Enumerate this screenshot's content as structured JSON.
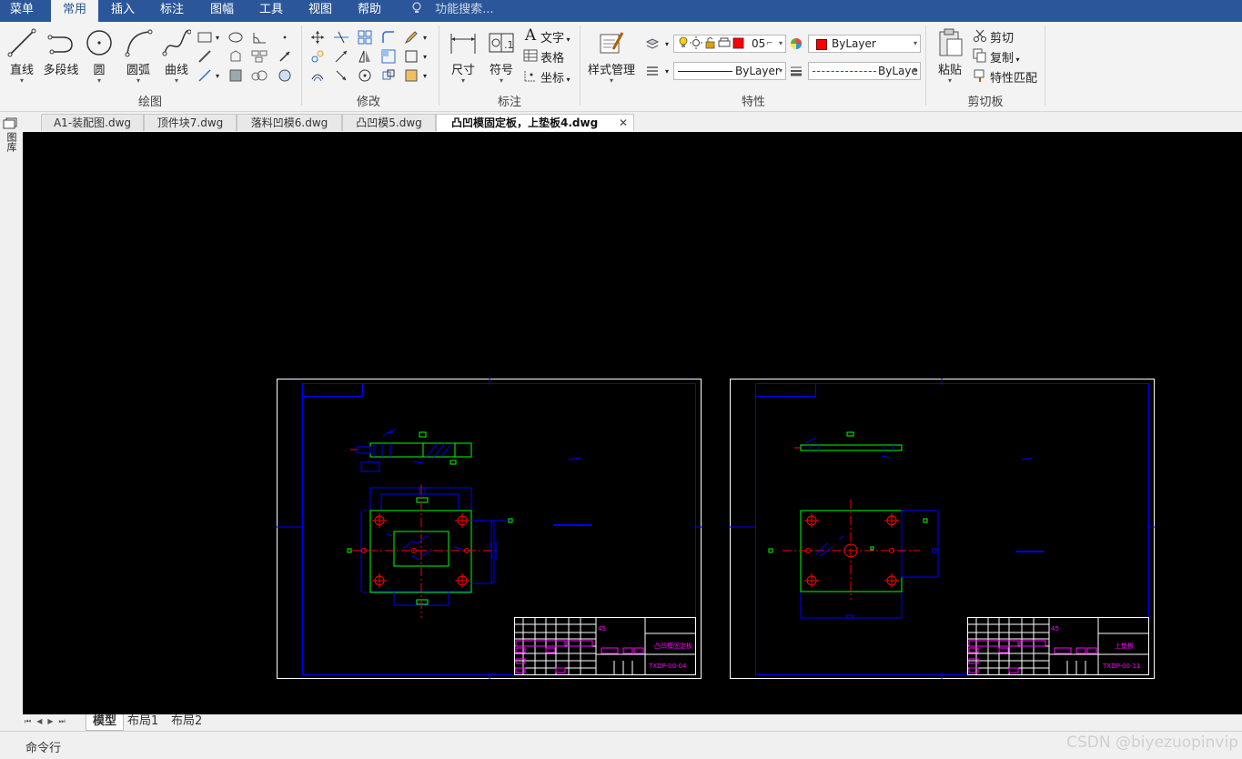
{
  "menubar": {
    "tabs": [
      "菜单",
      "常用",
      "插入",
      "标注",
      "图幅",
      "工具",
      "视图",
      "帮助"
    ],
    "active_index": 1,
    "search_placeholder": "功能搜索..."
  },
  "ribbon": {
    "draw": {
      "title": "绘图",
      "line": "直线",
      "polyline": "多段线",
      "circle": "圆",
      "arc": "圆弧",
      "curve": "曲线"
    },
    "modify": {
      "title": "修改"
    },
    "annotate": {
      "title": "标注",
      "dimension": "尺寸",
      "symbol": "符号",
      "text": "文字",
      "table": "表格",
      "coordinate": "坐标"
    },
    "properties": {
      "title": "特性",
      "style_manager": "样式管理",
      "layer_value": "05",
      "color_value": "ByLayer",
      "linetype_value": "ByLayer",
      "lineweight_value": "ByLaye"
    },
    "clipboard": {
      "title": "剪切板",
      "paste": "粘贴",
      "cut": "剪切",
      "copy": "复制",
      "match": "特性匹配"
    }
  },
  "doc_tabs": [
    "A1-装配图.dwg",
    "顶件块7.dwg",
    "落料凹模6.dwg",
    "凸凹模5.dwg",
    "凸凹模固定板，上垫板4.dwg"
  ],
  "active_doc_index": 4,
  "left_strip_label": "图库",
  "drawings": [
    {
      "material": "45",
      "name": "凸凹模固定板",
      "code": "TXDP-00-04"
    },
    {
      "material": "45",
      "name": "上垫板",
      "code": "TXDP-00-11"
    }
  ],
  "layout_tabs": [
    "模型",
    "布局1",
    "布局2"
  ],
  "command_label": "命令行",
  "watermark": "CSDN @biyezuopinvip",
  "colors": {
    "menubar": "#2b579a",
    "canvas": "#000000",
    "frame_inner": "#0000ff",
    "part_outline": "#00ff00",
    "center_line": "#ff0000",
    "title_block_text": "#ff00ff"
  }
}
